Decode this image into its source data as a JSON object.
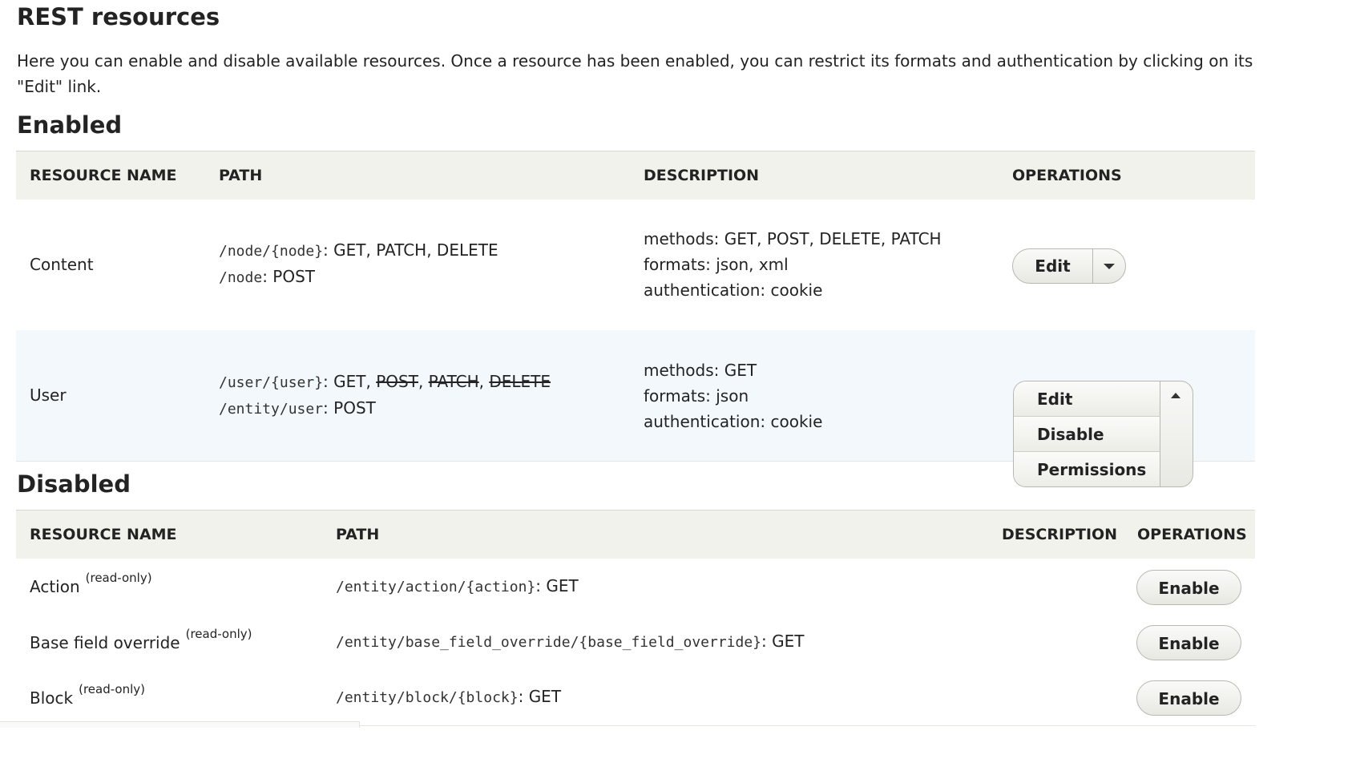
{
  "page": {
    "title": "REST resources",
    "intro": "Here you can enable and disable available resources. Once a resource has been enabled, you can restrict its formats and authentication by clicking on its \"Edit\" link."
  },
  "enabled": {
    "heading": "Enabled",
    "columns": [
      "RESOURCE NAME",
      "PATH",
      "DESCRIPTION",
      "OPERATIONS"
    ],
    "rows": [
      {
        "name": "Content",
        "paths": [
          {
            "path": "/node/{node}",
            "sep": ": ",
            "methods": [
              {
                "m": "GET",
                "sep": ", "
              },
              {
                "m": "PATCH",
                "sep": ", "
              },
              {
                "m": "DELETE",
                "sep": ""
              }
            ]
          },
          {
            "path": "/node",
            "sep": ": ",
            "methods": [
              {
                "m": "POST",
                "sep": ""
              }
            ]
          }
        ],
        "description": [
          "methods: GET, POST, DELETE, PATCH",
          "formats: json, xml",
          "authentication: cookie"
        ],
        "operation": "Edit"
      },
      {
        "name": "User",
        "paths": [
          {
            "path": "/user/{user}",
            "sep": ": ",
            "methods": [
              {
                "m": "GET",
                "sep": ", "
              },
              {
                "m": "POST",
                "sep": ", ",
                "strike": true
              },
              {
                "m": "PATCH",
                "sep": ", ",
                "strike": true
              },
              {
                "m": "DELETE",
                "sep": "",
                "strike": true
              }
            ]
          },
          {
            "path": "/entity/user",
            "sep": ": ",
            "methods": [
              {
                "m": "POST",
                "sep": ""
              }
            ]
          }
        ],
        "description": [
          "methods: GET",
          "formats: json",
          "authentication: cookie"
        ],
        "operations": [
          "Edit",
          "Disable",
          "Permissions"
        ]
      }
    ]
  },
  "disabled": {
    "heading": "Disabled",
    "columns": [
      "RESOURCE NAME",
      "PATH",
      "DESCRIPTION",
      "OPERATIONS"
    ],
    "rows": [
      {
        "name": "Action",
        "note": "(read-only)",
        "path": "/entity/action/{action}",
        "sep": ": ",
        "method": "GET",
        "operation": "Enable"
      },
      {
        "name": "Base field override",
        "note": "(read-only)",
        "path": "/entity/base_field_override/{base_field_override}",
        "sep": ": ",
        "method": "GET",
        "operation": "Enable"
      },
      {
        "name": "Block",
        "note": "(read-only)",
        "path": "/entity/block/{block}",
        "sep": ": ",
        "method": "GET",
        "operation": "Enable"
      }
    ]
  }
}
